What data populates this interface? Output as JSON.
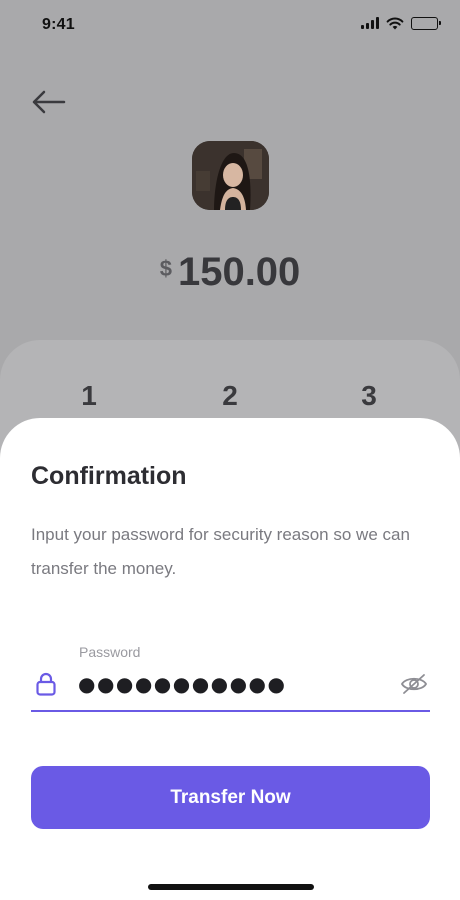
{
  "status_bar": {
    "time": "9:41",
    "icons": [
      "signal-icon",
      "wifi-icon",
      "battery-icon"
    ]
  },
  "transfer": {
    "currency": "$",
    "amount": "150.00",
    "back_icon": "arrow-left-icon"
  },
  "keypad": {
    "visible_keys": [
      "1",
      "2",
      "3"
    ]
  },
  "confirmation": {
    "title": "Confirmation",
    "description": "Input your password for security reason so we can transfer the money.",
    "password_label": "Password",
    "password_value": "●●●●●●●●●●●",
    "lock_icon": "lock-icon",
    "visibility_icon": "eye-off-icon",
    "submit_label": "Transfer Now"
  },
  "colors": {
    "accent": "#6a5ae5",
    "overlay": "#a9a9ab",
    "sheet": "#ffffff",
    "title_text": "#2d2d32",
    "muted_text": "#7a7a80"
  }
}
